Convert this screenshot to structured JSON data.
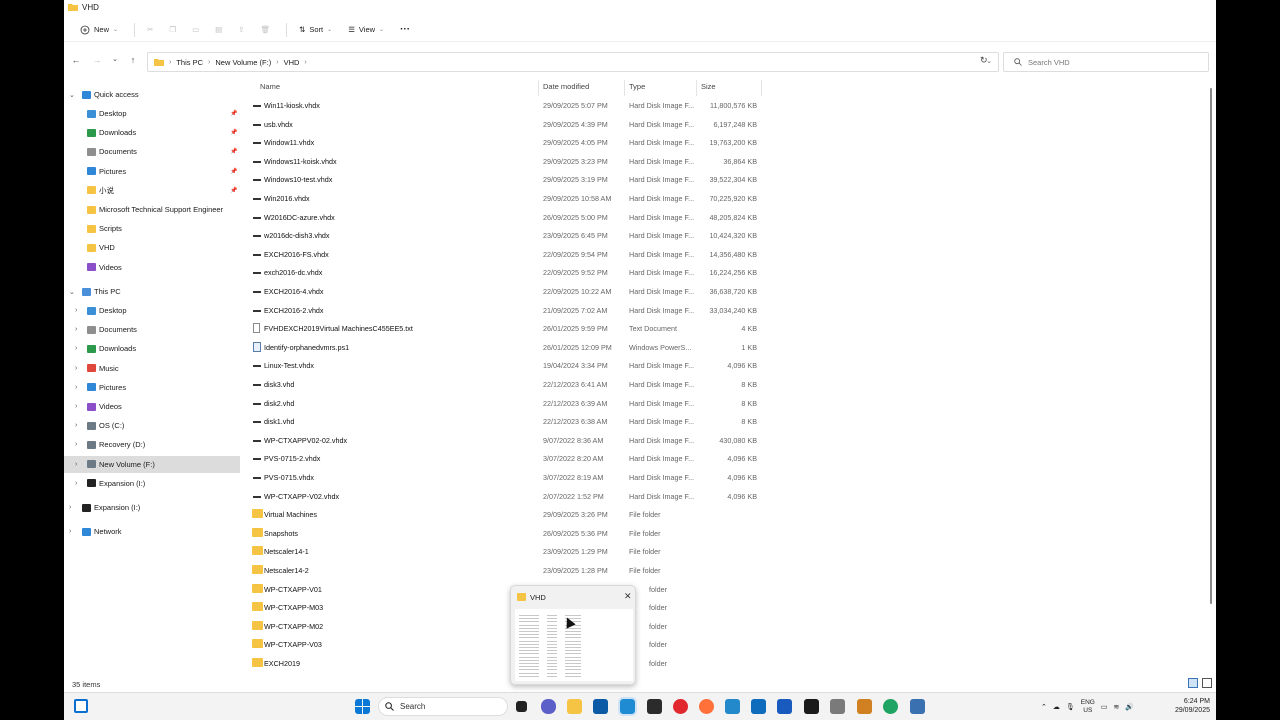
{
  "window": {
    "title": "VHD"
  },
  "toolbar": {
    "new_label": "New",
    "sort_label": "Sort",
    "view_label": "View",
    "more_label": "···"
  },
  "address": {
    "segments": [
      "This PC",
      "New Volume (F:)",
      "VHD"
    ],
    "search_placeholder": "Search VHD"
  },
  "nav": {
    "quick_access": "Quick access",
    "quick_items": [
      {
        "label": "Desktop",
        "icon": "desktop-icon",
        "pinned": true
      },
      {
        "label": "Downloads",
        "icon": "downloads-icon",
        "pinned": true
      },
      {
        "label": "Documents",
        "icon": "documents-icon",
        "pinned": true
      },
      {
        "label": "Pictures",
        "icon": "pictures-icon",
        "pinned": true
      },
      {
        "label": "小说",
        "icon": "folder-icon",
        "pinned": true
      },
      {
        "label": "Microsoft Technical Support Engineer",
        "icon": "folder-icon",
        "pinned": false
      },
      {
        "label": "Scripts",
        "icon": "folder-icon",
        "pinned": false
      },
      {
        "label": "VHD",
        "icon": "folder-icon",
        "pinned": false
      },
      {
        "label": "Videos",
        "icon": "videos-icon",
        "pinned": false
      }
    ],
    "this_pc": "This PC",
    "pc_items": [
      {
        "label": "Desktop",
        "icon": "desktop-icon"
      },
      {
        "label": "Documents",
        "icon": "documents-icon"
      },
      {
        "label": "Downloads",
        "icon": "downloads-icon"
      },
      {
        "label": "Music",
        "icon": "music-icon"
      },
      {
        "label": "Pictures",
        "icon": "pictures-icon"
      },
      {
        "label": "Videos",
        "icon": "videos-icon"
      },
      {
        "label": "OS (C:)",
        "icon": "drive-icon"
      },
      {
        "label": "Recovery (D:)",
        "icon": "drive-icon"
      },
      {
        "label": "New Volume (F:)",
        "icon": "drive-icon"
      },
      {
        "label": "Expansion (I:)",
        "icon": "usb-drive-icon"
      }
    ],
    "expansion": "Expansion (I:)",
    "network": "Network"
  },
  "columns": {
    "name": "Name",
    "date": "Date modified",
    "type": "Type",
    "size": "Size"
  },
  "files": [
    {
      "name": "Win11-kiosk.vhdx",
      "date": "29/09/2025 5:07 PM",
      "type": "Hard Disk Image F...",
      "size": "11,800,576 KB",
      "icon": "disk"
    },
    {
      "name": "usb.vhdx",
      "date": "29/09/2025 4:39 PM",
      "type": "Hard Disk Image F...",
      "size": "6,197,248 KB",
      "icon": "disk"
    },
    {
      "name": "Window11.vhdx",
      "date": "29/09/2025 4:05 PM",
      "type": "Hard Disk Image F...",
      "size": "19,763,200 KB",
      "icon": "disk"
    },
    {
      "name": "Windows11-koisk.vhdx",
      "date": "29/09/2025 3:23 PM",
      "type": "Hard Disk Image F...",
      "size": "36,864 KB",
      "icon": "disk"
    },
    {
      "name": "Windows10-test.vhdx",
      "date": "29/09/2025 3:19 PM",
      "type": "Hard Disk Image F...",
      "size": "39,522,304 KB",
      "icon": "disk"
    },
    {
      "name": "Win2016.vhdx",
      "date": "29/09/2025 10:58 AM",
      "type": "Hard Disk Image F...",
      "size": "70,225,920 KB",
      "icon": "disk"
    },
    {
      "name": "W2016DC-azure.vhdx",
      "date": "26/09/2025 5:00 PM",
      "type": "Hard Disk Image F...",
      "size": "48,205,824 KB",
      "icon": "disk"
    },
    {
      "name": "w2016dc-dish3.vhdx",
      "date": "23/09/2025 6:45 PM",
      "type": "Hard Disk Image F...",
      "size": "10,424,320 KB",
      "icon": "disk"
    },
    {
      "name": "EXCH2016-FS.vhdx",
      "date": "22/09/2025 9:54 PM",
      "type": "Hard Disk Image F...",
      "size": "14,356,480 KB",
      "icon": "disk"
    },
    {
      "name": "exch2016-dc.vhdx",
      "date": "22/09/2025 9:52 PM",
      "type": "Hard Disk Image F...",
      "size": "16,224,256 KB",
      "icon": "disk"
    },
    {
      "name": "EXCH2016-4.vhdx",
      "date": "22/09/2025 10:22 AM",
      "type": "Hard Disk Image F...",
      "size": "36,638,720 KB",
      "icon": "disk"
    },
    {
      "name": "EXCH2016-2.vhdx",
      "date": "21/09/2025 7:02 AM",
      "type": "Hard Disk Image F...",
      "size": "33,034,240 KB",
      "icon": "disk"
    },
    {
      "name": "FVHDEXCH2019Virtual MachinesC455EE5.txt",
      "date": "26/01/2025 9:59 PM",
      "type": "Text Document",
      "size": "4 KB",
      "icon": "txt"
    },
    {
      "name": "Identify-orphanedvmrs.ps1",
      "date": "26/01/2025 12:09 PM",
      "type": "Windows PowerS...",
      "size": "1 KB",
      "icon": "ps"
    },
    {
      "name": "Linux-Test.vhdx",
      "date": "19/04/2024 3:34 PM",
      "type": "Hard Disk Image F...",
      "size": "4,096 KB",
      "icon": "disk"
    },
    {
      "name": "disk3.vhd",
      "date": "22/12/2023 6:41 AM",
      "type": "Hard Disk Image F...",
      "size": "8 KB",
      "icon": "disk"
    },
    {
      "name": "disk2.vhd",
      "date": "22/12/2023 6:39 AM",
      "type": "Hard Disk Image F...",
      "size": "8 KB",
      "icon": "disk"
    },
    {
      "name": "disk1.vhd",
      "date": "22/12/2023 6:38 AM",
      "type": "Hard Disk Image F...",
      "size": "8 KB",
      "icon": "disk"
    },
    {
      "name": "WP-CTXAPPV02-02.vhdx",
      "date": "9/07/2022 8:36 AM",
      "type": "Hard Disk Image F...",
      "size": "430,080 KB",
      "icon": "disk"
    },
    {
      "name": "PVS-0715-2.vhdx",
      "date": "3/07/2022 8:20 AM",
      "type": "Hard Disk Image F...",
      "size": "4,096 KB",
      "icon": "disk"
    },
    {
      "name": "PVS-0715.vhdx",
      "date": "3/07/2022 8:19 AM",
      "type": "Hard Disk Image F...",
      "size": "4,096 KB",
      "icon": "disk"
    },
    {
      "name": "WP-CTXAPP-V02.vhdx",
      "date": "2/07/2022 1:52 PM",
      "type": "Hard Disk Image F...",
      "size": "4,096 KB",
      "icon": "disk"
    },
    {
      "name": "Virtual Machines",
      "date": "29/09/2025 3:26 PM",
      "type": "File folder",
      "size": "",
      "icon": "folder"
    },
    {
      "name": "Snapshots",
      "date": "26/09/2025 5:36 PM",
      "type": "File folder",
      "size": "",
      "icon": "folder"
    },
    {
      "name": "Netscaler14-1",
      "date": "23/09/2025 1:29 PM",
      "type": "File folder",
      "size": "",
      "icon": "folder"
    },
    {
      "name": "Netscaler14-2",
      "date": "23/09/2025 1:28 PM",
      "type": "File folder",
      "size": "",
      "icon": "folder"
    },
    {
      "name": "WP-CTXAPP-V01",
      "date": "",
      "type": "folder",
      "size": "",
      "icon": "folder"
    },
    {
      "name": "WP-CTXAPP-M03",
      "date": "",
      "type": "folder",
      "size": "",
      "icon": "folder"
    },
    {
      "name": "WP-CTXAPP-M02",
      "date": "",
      "type": "folder",
      "size": "",
      "icon": "folder"
    },
    {
      "name": "WP-CTXAPP-V03",
      "date": "",
      "type": "folder",
      "size": "",
      "icon": "folder"
    },
    {
      "name": "EXCH2019",
      "date": "",
      "type": "folder",
      "size": "",
      "icon": "folder"
    }
  ],
  "status": {
    "count": "35 items"
  },
  "thumbnail": {
    "title": "VHD"
  },
  "taskbar": {
    "search_label": "Search",
    "lang_top": "ENG",
    "lang_bottom": "US",
    "time": "6:24 PM",
    "date": "29/09/2025"
  },
  "colors": {
    "folder": "#f6c444",
    "accent": "#0067c0",
    "selected": "#dcdcdc"
  }
}
